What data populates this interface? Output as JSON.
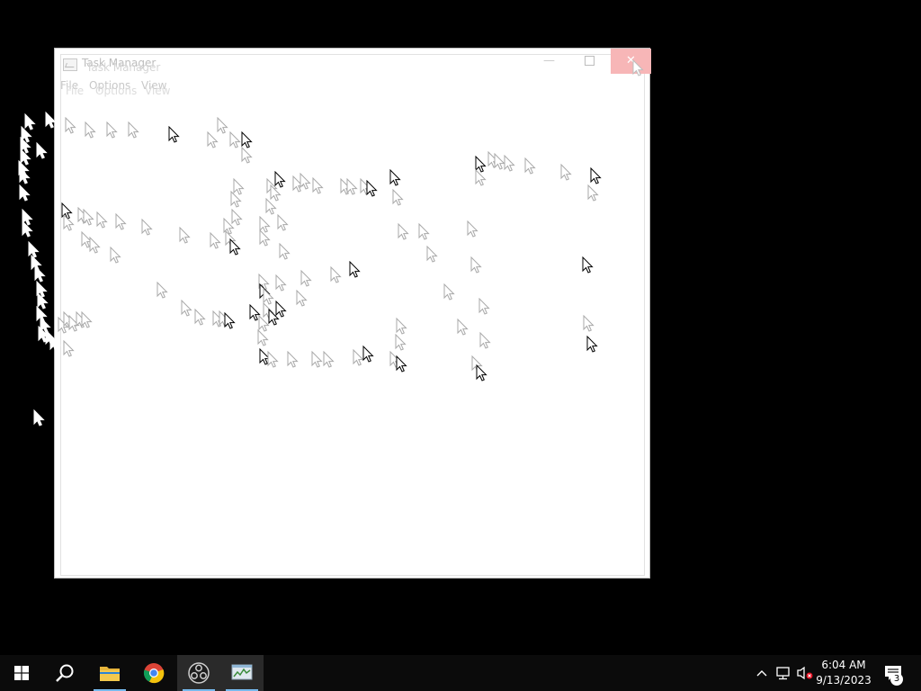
{
  "window": {
    "title": "Task Manager",
    "menu": [
      "File",
      "Options",
      "View"
    ],
    "minimize_glyph": "—",
    "close_glyph": "✕"
  },
  "taskbar": {
    "items": [
      {
        "name": "start",
        "icon": "windows-logo-icon"
      },
      {
        "name": "search",
        "icon": "search-icon"
      },
      {
        "name": "file-explorer",
        "icon": "folder-icon"
      },
      {
        "name": "chrome",
        "icon": "chrome-icon"
      },
      {
        "name": "obs",
        "icon": "obs-icon"
      },
      {
        "name": "task-manager",
        "icon": "task-manager-icon"
      }
    ],
    "tray": {
      "time": "6:04 AM",
      "date": "9/13/2023",
      "notification_count": "3"
    }
  },
  "colors": {
    "desktop": "#000000",
    "taskbar": "#0b0b0b",
    "close_hover": "#f7b6b7",
    "accent": "#76b9ed"
  }
}
